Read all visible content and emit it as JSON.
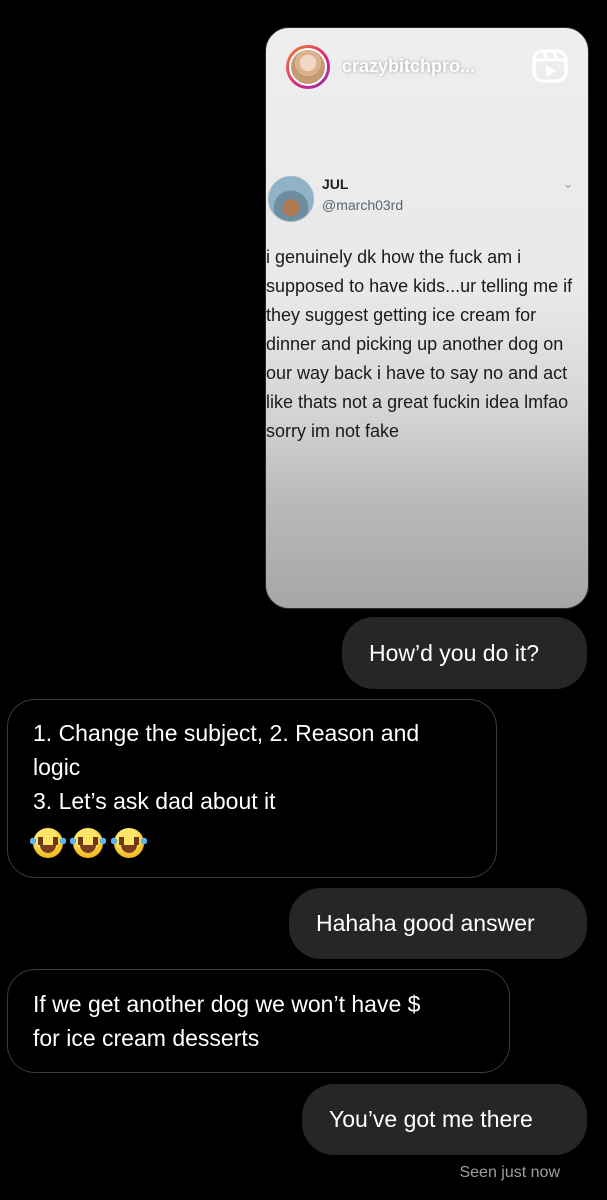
{
  "reel_card": {
    "username": "crazybitchpro...",
    "reels_icon": "reels-icon",
    "tweet": {
      "name": "JUL",
      "handle": "@march03rd",
      "text": "i genuinely dk how the fuck am i\nsupposed to have kids...ur telling me if\nthey suggest getting ice cream for\ndinner and picking up another dog on\nour way back i have to say no and act\nlike thats not a great fuckin idea lmfao\nsorry im not fake"
    }
  },
  "messages": [
    {
      "sender": "me",
      "text": "How’d you do it?"
    },
    {
      "sender": "them",
      "lines": [
        "1. Change the subject, 2. Reason and",
        "logic",
        "3. Let’s ask dad about it"
      ],
      "emoji": [
        "face-with-tears-of-joy",
        "face-with-tears-of-joy",
        "face-with-tears-of-joy"
      ]
    },
    {
      "sender": "me",
      "text": "Hahaha good answer"
    },
    {
      "sender": "them",
      "lines": [
        "If we get another dog we won’t have $",
        "for ice cream desserts"
      ]
    },
    {
      "sender": "me",
      "text": "You’ve got me there"
    }
  ],
  "seen_status": "Seen just now",
  "colors": {
    "background": "#000000",
    "sent_bubble": "#262626",
    "received_border": "#3a3a3a",
    "seen_text": "#9e9e9e"
  }
}
